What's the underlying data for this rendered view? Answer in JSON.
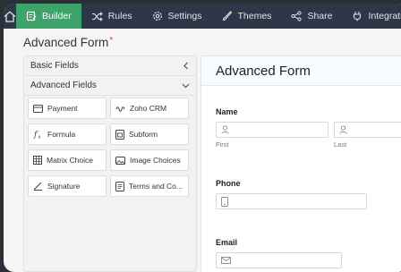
{
  "nav": {
    "items": [
      {
        "label": "Builder",
        "icon": "builder-icon",
        "active": true
      },
      {
        "label": "Rules",
        "icon": "shuffle-icon",
        "active": false
      },
      {
        "label": "Settings",
        "icon": "gear-icon",
        "active": false
      },
      {
        "label": "Themes",
        "icon": "brush-icon",
        "active": false
      },
      {
        "label": "Share",
        "icon": "share-icon",
        "active": false
      },
      {
        "label": "Integratio",
        "icon": "plug-icon",
        "active": false
      }
    ]
  },
  "page": {
    "title": "Advanced Form",
    "required_mark": "*"
  },
  "palette": {
    "basic_fields": "Basic Fields",
    "advanced_fields": "Advanced Fields",
    "tiles": [
      {
        "label": "Payment",
        "icon": "card-icon"
      },
      {
        "label": "Zoho CRM",
        "icon": "crm-icon"
      },
      {
        "label": "Formula",
        "icon": "formula-icon"
      },
      {
        "label": "Subform",
        "icon": "subform-icon"
      },
      {
        "label": "Matrix Choice",
        "icon": "matrix-icon"
      },
      {
        "label": "Image Choices",
        "icon": "image-icon"
      },
      {
        "label": "Signature",
        "icon": "signature-icon"
      },
      {
        "label": "Terms and Co...",
        "icon": "terms-icon"
      }
    ]
  },
  "canvas": {
    "title": "Advanced Form",
    "name_label": "Name",
    "first_label": "First",
    "last_label": "Last",
    "phone_label": "Phone",
    "email_label": "Email"
  }
}
